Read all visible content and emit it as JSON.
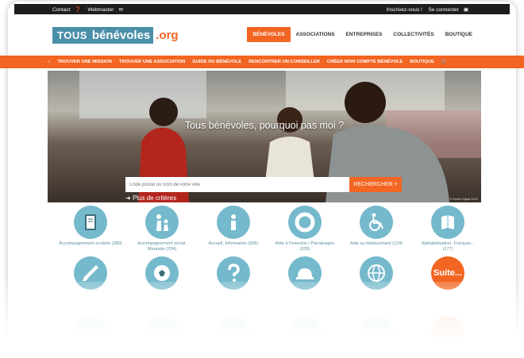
{
  "topbar": {
    "contact": "Contact",
    "webmaster": "Webmaster",
    "register": "Inscrivez-vous !",
    "login": "Se connecter"
  },
  "logo": {
    "tous": "TOUS",
    "benevoles": "bénévoles",
    "org": ".org"
  },
  "mainnav": [
    "BÉNÉVOLES",
    "ASSOCIATIONS",
    "ENTREPRISES",
    "COLLECTIVITÉS",
    "BOUTIQUE"
  ],
  "subnav": [
    "TROUVER UNE MISSION",
    "TROUVER UNE ASSOCIATION",
    "GUIDE DU BÉNÉVOLE",
    "RENCONTRER UN CONSEILLER",
    "CRÉER MON COMPTE BÉNÉVOLE",
    "BOUTIQUE"
  ],
  "hero": {
    "title": "Tous bénévoles, pourquoi pas moi ?",
    "search_placeholder": "Code postal ou nom de votre ville",
    "search_button": "RECHERCHER >",
    "more_criteria": "Plus de critères",
    "credit": "© Emilie Mijad 2013"
  },
  "categories": [
    {
      "label": "Accompagnement scolaire (380)",
      "icon": "notebook-icon"
    },
    {
      "label": "Accompagnement social, Maraude (234)",
      "icon": "people-icon"
    },
    {
      "label": "Accueil, Information (306)",
      "icon": "info-icon"
    },
    {
      "label": "Aide à l'insertion / Parrainages (339)",
      "icon": "lifebuoy-icon"
    },
    {
      "label": "Aide au déplacement (124)",
      "icon": "wheelchair-icon"
    },
    {
      "label": "Alphabétisation, Français... (177)",
      "icon": "book-icon"
    },
    {
      "label": "",
      "icon": "brush-icon"
    },
    {
      "label": "",
      "icon": "soccer-ball-icon"
    },
    {
      "label": "",
      "icon": "question-icon"
    },
    {
      "label": "",
      "icon": "hardhat-icon"
    },
    {
      "label": "",
      "icon": "globe-icon"
    },
    {
      "label": "Suite...",
      "icon": "more-button"
    }
  ],
  "colors": {
    "orange": "#f26522",
    "teal": "#75b9cc",
    "logo_blue": "#4a8fa8"
  }
}
